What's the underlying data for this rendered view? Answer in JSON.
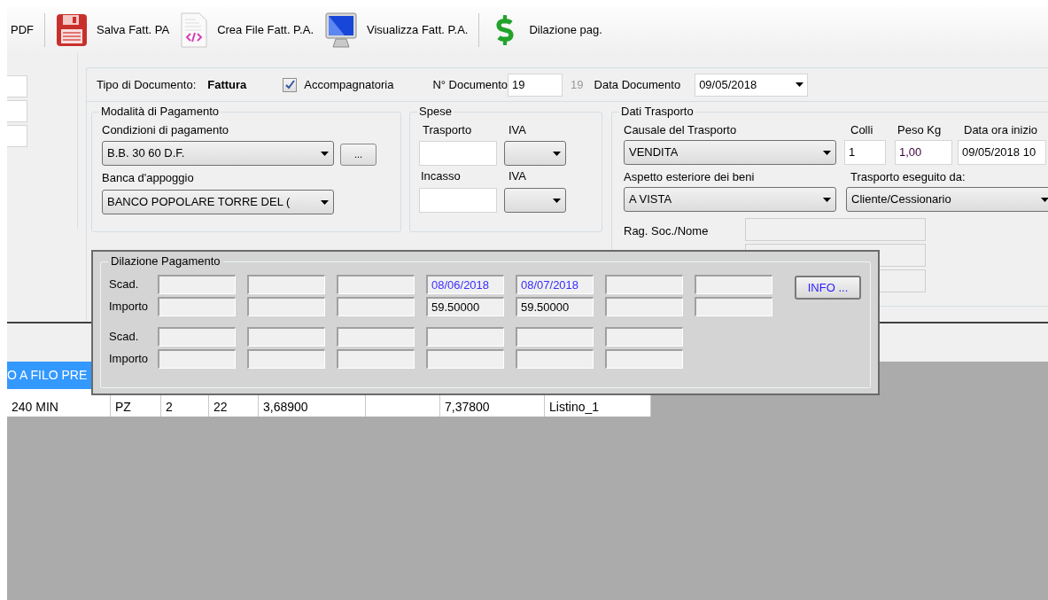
{
  "toolbar": [
    {
      "kind": "text",
      "label": "PDF"
    },
    {
      "kind": "separator"
    },
    {
      "kind": "floppy",
      "label": "Salva Fatt. PA"
    },
    {
      "kind": "document",
      "label": "Crea File Fatt. P.A."
    },
    {
      "kind": "monitor",
      "label": "Visualizza Fatt. P.A."
    },
    {
      "kind": "separator"
    },
    {
      "kind": "dollar",
      "label": "Dilazione pag."
    }
  ],
  "header": {
    "tipo_label": "Tipo di Documento:",
    "tipo_value": "Fattura",
    "accompagnatoria": {
      "label": "Accompagnatoria",
      "checked": true
    },
    "numero_label": "N° Documento",
    "numero_value": "19",
    "numero_suffix": "19",
    "data_label": "Data Documento",
    "data_value": "09/05/2018"
  },
  "pagamento": {
    "title": "Modalità di Pagamento",
    "condizioni_label": "Condizioni di pagamento",
    "condizioni_value": "B.B. 30  60 D.F.",
    "more_button": "...",
    "banca_label": "Banca d'appoggio",
    "banca_value": "BANCO POPOLARE TORRE DEL ("
  },
  "spese": {
    "title": "Spese",
    "trasporto_label": "Trasporto",
    "iva_label_1": "IVA",
    "incasso_label": "Incasso",
    "iva_label_2": "IVA"
  },
  "trasporto": {
    "title": "Dati Trasporto",
    "causale_label": "Causale del Trasporto",
    "causale_value": "VENDITA",
    "colli_label": "Colli",
    "colli_value": "1",
    "peso_label": "Peso Kg",
    "peso_value": "1,00",
    "data_label": "Data ora inizio",
    "data_value": "09/05/2018 10",
    "aspetto_label": "Aspetto esteriore dei beni",
    "aspetto_value": "A VISTA",
    "eseguito_label": "Trasporto eseguito da:",
    "eseguito_value": "Cliente/Cessionario",
    "ragsoc_label": "Rag. Soc./Nome"
  },
  "list": {
    "selected_row": {
      "text": "O A FILO PRE",
      "selected": true
    },
    "row": [
      {
        "kind": "text",
        "value": "240 MIN"
      },
      {
        "kind": "text",
        "value": "PZ"
      },
      {
        "kind": "text",
        "value": "2"
      },
      {
        "kind": "text",
        "value": "22"
      },
      {
        "kind": "text",
        "value": "3,68900"
      },
      {
        "kind": "empty"
      },
      {
        "kind": "text",
        "value": "7,37800"
      },
      {
        "kind": "text",
        "value": "Listino_1"
      }
    ]
  },
  "dilazione": {
    "title": "Dilazione Pagamento",
    "info_button": "INFO ...",
    "blocks": [
      {
        "rows": [
          {
            "kind": "date",
            "label": "Scad.",
            "cells": [
              {
                "kind": "empty"
              },
              {
                "kind": "empty"
              },
              {
                "kind": "empty"
              },
              {
                "kind": "text",
                "value": "08/06/2018"
              },
              {
                "kind": "text",
                "value": "08/07/2018"
              },
              {
                "kind": "empty"
              },
              {
                "kind": "empty"
              }
            ]
          },
          {
            "kind": "amount",
            "label": "Importo",
            "cells": [
              {
                "kind": "empty"
              },
              {
                "kind": "empty"
              },
              {
                "kind": "empty"
              },
              {
                "kind": "text",
                "value": "59.50000"
              },
              {
                "kind": "text",
                "value": "59.50000"
              },
              {
                "kind": "empty"
              },
              {
                "kind": "empty"
              }
            ]
          }
        ]
      },
      {
        "rows": [
          {
            "kind": "date",
            "label": "Scad.",
            "cells": [
              {
                "kind": "empty"
              },
              {
                "kind": "empty"
              },
              {
                "kind": "empty"
              },
              {
                "kind": "empty"
              },
              {
                "kind": "empty"
              },
              {
                "kind": "empty"
              }
            ]
          },
          {
            "kind": "amount",
            "label": "Importo",
            "cells": [
              {
                "kind": "empty"
              },
              {
                "kind": "empty"
              },
              {
                "kind": "empty"
              },
              {
                "kind": "empty"
              },
              {
                "kind": "empty"
              },
              {
                "kind": "empty"
              }
            ]
          }
        ]
      }
    ]
  }
}
